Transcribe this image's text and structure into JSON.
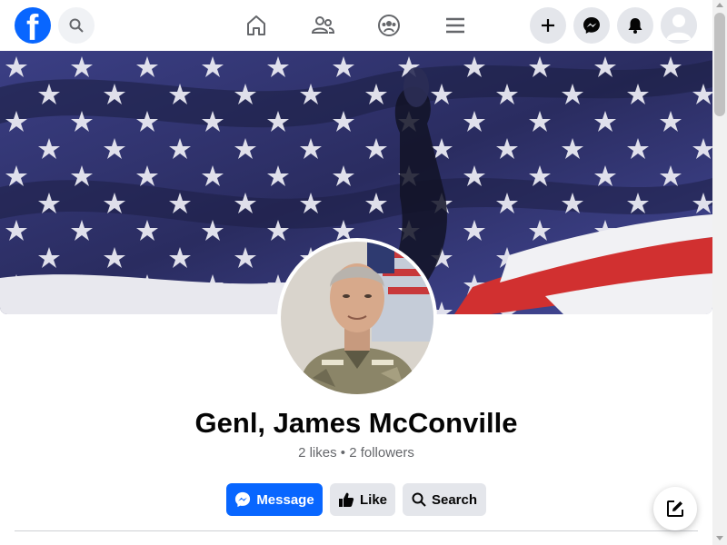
{
  "header": {
    "logo_letter": "f",
    "nav_icons": [
      "home-icon",
      "friends-icon",
      "groups-icon",
      "menu-icon"
    ],
    "actions": [
      "plus-icon",
      "messenger-icon",
      "bell-icon",
      "account-avatar"
    ]
  },
  "profile": {
    "name": "Genl, James McConville",
    "stats": "2 likes • 2 followers"
  },
  "buttons": {
    "message": "Message",
    "like": "Like",
    "search": "Search"
  },
  "colors": {
    "brand": "#0866ff",
    "secondary_bg": "#e4e6eb",
    "muted_text": "#65676b"
  }
}
